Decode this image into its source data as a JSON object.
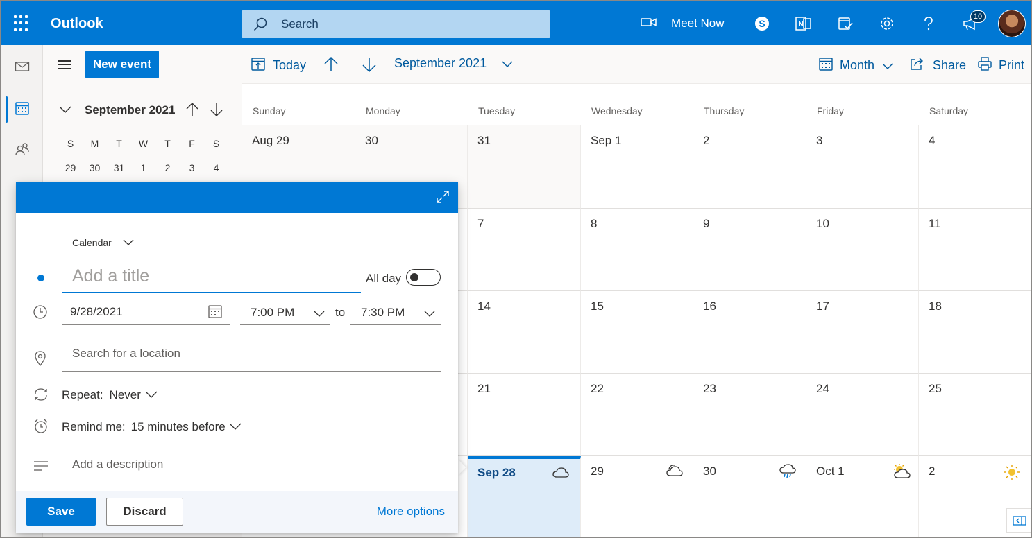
{
  "app": {
    "title": "Outlook"
  },
  "search": {
    "placeholder": "Search"
  },
  "topbar": {
    "meet_now": "Meet Now",
    "notification_count": "10",
    "icons": [
      "app-launcher-icon",
      "search-icon",
      "video-camera-icon",
      "skype-icon",
      "onenote-icon",
      "my-day-icon",
      "settings-gear-icon",
      "help-icon",
      "megaphone-icon"
    ]
  },
  "left_pane": {
    "new_event": "New event",
    "mini_calendar": {
      "title": "September 2021",
      "weekdays": [
        "S",
        "M",
        "T",
        "W",
        "T",
        "F",
        "S"
      ],
      "first_row": [
        "29",
        "30",
        "31",
        "1",
        "2",
        "3",
        "4"
      ]
    }
  },
  "toolbar": {
    "today": "Today",
    "month_range": "September 2021",
    "view": "Month",
    "share": "Share",
    "print": "Print"
  },
  "calendar": {
    "day_names": [
      "Sunday",
      "Monday",
      "Tuesday",
      "Wednesday",
      "Thursday",
      "Friday",
      "Saturday"
    ],
    "weeks": [
      [
        "Aug 29",
        "30",
        "31",
        "Sep 1",
        "2",
        "3",
        "4"
      ],
      [
        "",
        "",
        "7",
        "8",
        "9",
        "10",
        "11"
      ],
      [
        "",
        "",
        "14",
        "15",
        "16",
        "17",
        "18"
      ],
      [
        "",
        "",
        "21",
        "22",
        "23",
        "24",
        "25"
      ],
      [
        "",
        "",
        "Sep 28",
        "29",
        "30",
        "Oct 1",
        "2"
      ]
    ],
    "weather_icons": [
      "cloud-icon",
      "partly-cloudy-icon",
      "rain-cloud-icon",
      "partly-sunny-icon",
      "sunny-icon"
    ]
  },
  "event_form": {
    "calendar_select": "Calendar",
    "title_placeholder": "Add a title",
    "all_day_label": "All day",
    "all_day_on": false,
    "date": "9/28/2021",
    "start_time": "7:00 PM",
    "to_label": "to",
    "end_time": "7:30 PM",
    "location_placeholder": "Search for a location",
    "repeat_label": "Repeat:",
    "repeat_value": "Never",
    "remind_label": "Remind me:",
    "remind_value": "15 minutes before",
    "description_placeholder": "Add a description",
    "save": "Save",
    "discard": "Discard",
    "more_options": "More options"
  },
  "colors": {
    "brand": "#0078d4",
    "today_bg": "#deecf9"
  }
}
